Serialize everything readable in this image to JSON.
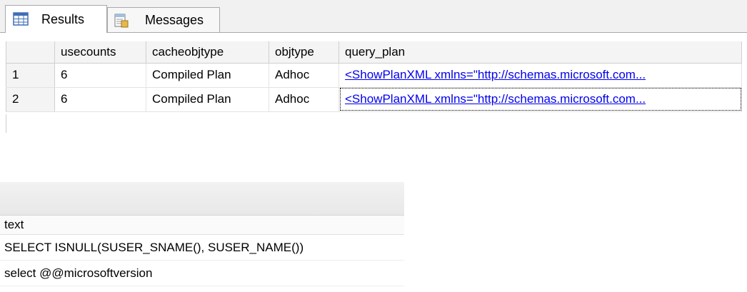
{
  "tabs": [
    {
      "label": "Results",
      "icon": "grid-icon",
      "active": true
    },
    {
      "label": "Messages",
      "icon": "messages-icon",
      "active": false
    }
  ],
  "results_grid": {
    "columns": [
      "usecounts",
      "cacheobjtype",
      "objtype",
      "query_plan"
    ],
    "rows": [
      {
        "row_number": "1",
        "usecounts": "6",
        "cacheobjtype": "Compiled Plan",
        "objtype": "Adhoc",
        "query_plan": "<ShowPlanXML xmlns=\"http://schemas.microsoft.com..."
      },
      {
        "row_number": "2",
        "usecounts": "6",
        "cacheobjtype": "Compiled Plan",
        "objtype": "Adhoc",
        "query_plan": "<ShowPlanXML xmlns=\"http://schemas.microsoft.com..."
      }
    ]
  },
  "text_grid": {
    "column": "text",
    "rows": [
      "SELECT ISNULL(SUSER_SNAME(), SUSER_NAME())",
      "select @@microsoftversion"
    ]
  },
  "colors": {
    "link": "#0000ee",
    "header_bg": "#f4f4f4",
    "tab_strip_bg": "#f1f1f1"
  }
}
